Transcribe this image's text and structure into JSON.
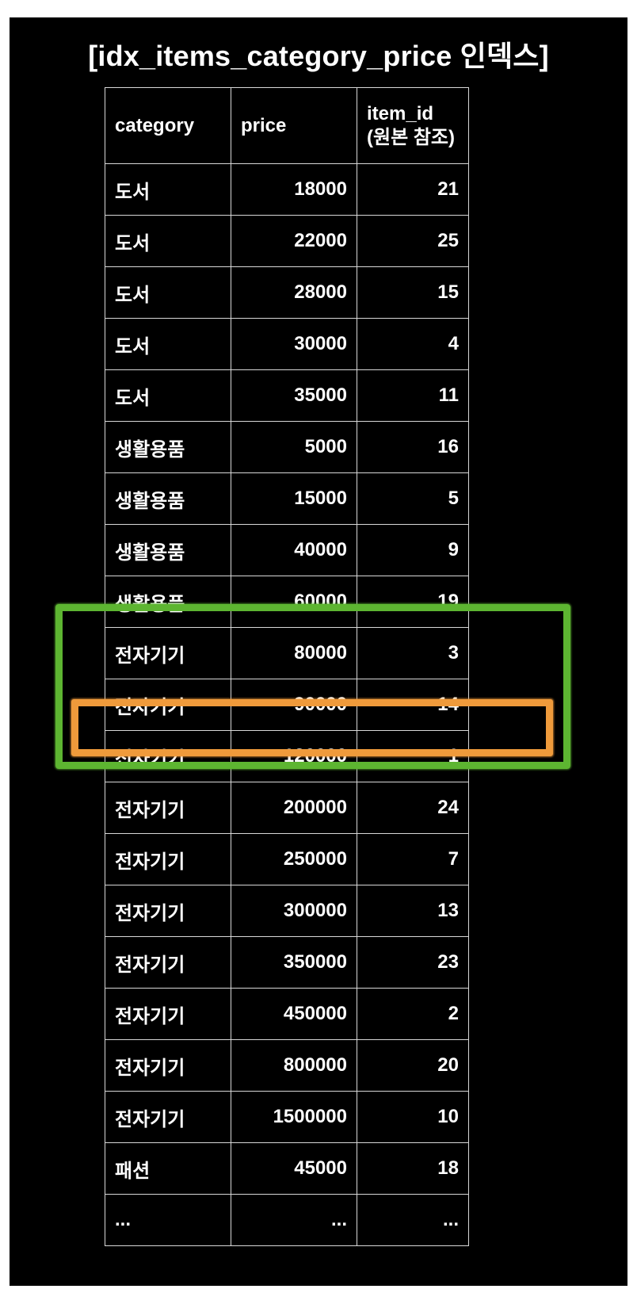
{
  "title": "[idx_items_category_price 인덱스]",
  "table": {
    "headers": {
      "category": "category",
      "price": "price",
      "item_id_line1": "item_id",
      "item_id_line2": "(원본 참조)"
    },
    "rows": [
      {
        "category": "도서",
        "price": "18000",
        "item_id": "21"
      },
      {
        "category": "도서",
        "price": "22000",
        "item_id": "25"
      },
      {
        "category": "도서",
        "price": "28000",
        "item_id": "15"
      },
      {
        "category": "도서",
        "price": "30000",
        "item_id": "4"
      },
      {
        "category": "도서",
        "price": "35000",
        "item_id": "11"
      },
      {
        "category": "생활용품",
        "price": "5000",
        "item_id": "16"
      },
      {
        "category": "생활용품",
        "price": "15000",
        "item_id": "5"
      },
      {
        "category": "생활용품",
        "price": "40000",
        "item_id": "9"
      },
      {
        "category": "생활용품",
        "price": "60000",
        "item_id": "19"
      },
      {
        "category": "전자기기",
        "price": "80000",
        "item_id": "3"
      },
      {
        "category": "전자기기",
        "price": "90000",
        "item_id": "14"
      },
      {
        "category": "전자기기",
        "price": "120000",
        "item_id": "1"
      },
      {
        "category": "전자기기",
        "price": "200000",
        "item_id": "24"
      },
      {
        "category": "전자기기",
        "price": "250000",
        "item_id": "7"
      },
      {
        "category": "전자기기",
        "price": "300000",
        "item_id": "13"
      },
      {
        "category": "전자기기",
        "price": "350000",
        "item_id": "23"
      },
      {
        "category": "전자기기",
        "price": "450000",
        "item_id": "2"
      },
      {
        "category": "전자기기",
        "price": "800000",
        "item_id": "20"
      },
      {
        "category": "전자기기",
        "price": "1500000",
        "item_id": "10"
      },
      {
        "category": "패션",
        "price": "45000",
        "item_id": "18"
      },
      {
        "category": "...",
        "price": "...",
        "item_id": "..."
      }
    ]
  },
  "colors": {
    "background": "#000000",
    "text": "#ffffff",
    "grid": "#d8d8d8",
    "green_highlight": "#5db531",
    "orange_highlight": "#ef9a3b"
  }
}
